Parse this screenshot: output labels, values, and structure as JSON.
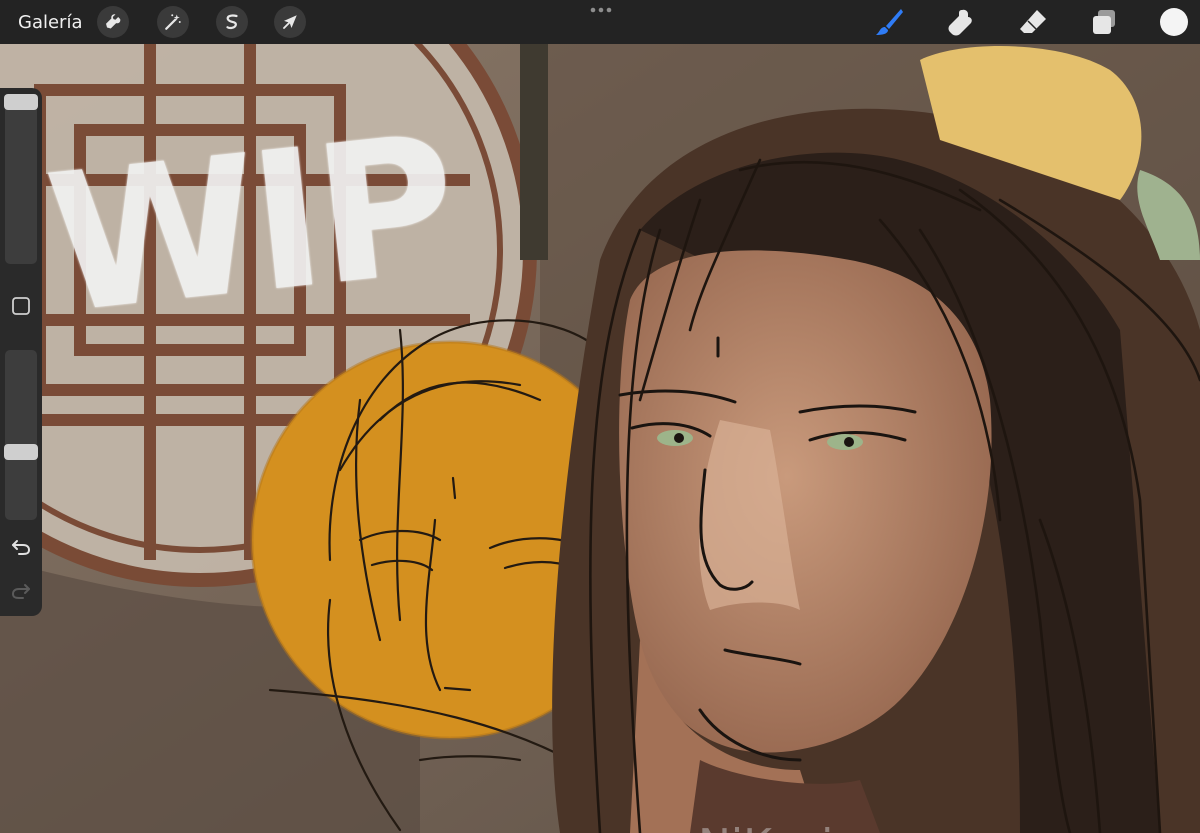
{
  "toolbar": {
    "gallery_label": "Galería",
    "left_tools": [
      "wrench-icon",
      "magic-wand-icon",
      "selection-icon",
      "transform-arrow-icon"
    ],
    "right_tools": [
      "brush-icon",
      "smudge-icon",
      "eraser-icon",
      "layers-icon"
    ],
    "active_tool": "brush-icon",
    "current_color": "#f4f4f4",
    "accent_color": "#2f7cf6"
  },
  "sidebar": {
    "controls": [
      "brush-size-slider",
      "modify-button",
      "opacity-slider",
      "undo-icon",
      "redo-icon"
    ]
  },
  "artwork": {
    "overlay_text": "WIP",
    "signature": "NiKasia",
    "colors": {
      "background": "#6b5b4d",
      "orange_circle": "#d4901f",
      "skin": "#b98466",
      "hair": "#3b2a22",
      "window_frame": "#7a4a35"
    }
  }
}
